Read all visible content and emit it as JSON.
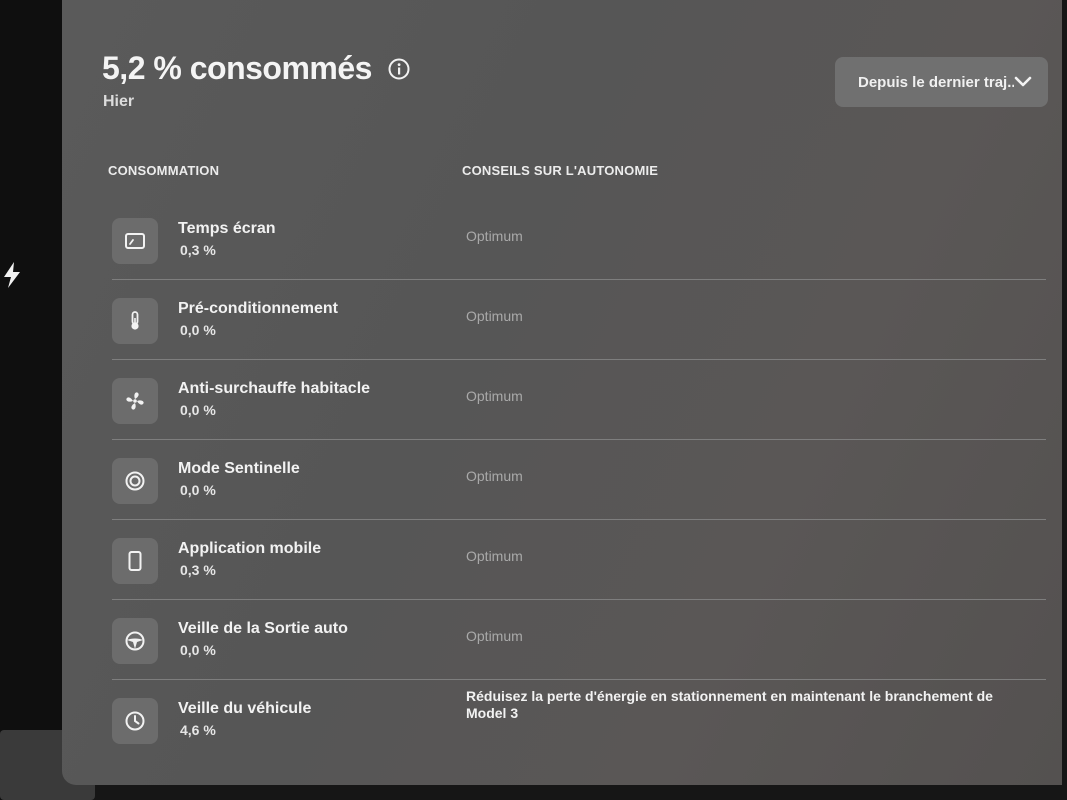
{
  "header": {
    "title": "5,2 % consommés",
    "subtitle": "Hier",
    "dropdown_label": "Depuis le dernier traj..."
  },
  "columns": {
    "consumption": "CONSOMMATION",
    "advice": "CONSEILS SUR L'AUTONOMIE"
  },
  "rows": [
    {
      "icon": "screen-icon",
      "name": "Temps écran",
      "value": "0,3 %",
      "advice": "Optimum"
    },
    {
      "icon": "thermometer-icon",
      "name": "Pré-conditionnement",
      "value": "0,0 %",
      "advice": "Optimum"
    },
    {
      "icon": "fan-icon",
      "name": "Anti-surchauffe habitacle",
      "value": "0,0 %",
      "advice": "Optimum"
    },
    {
      "icon": "sentry-icon",
      "name": "Mode Sentinelle",
      "value": "0,0 %",
      "advice": "Optimum"
    },
    {
      "icon": "phone-icon",
      "name": "Application mobile",
      "value": "0,3 %",
      "advice": "Optimum"
    },
    {
      "icon": "steering-wheel-icon",
      "name": "Veille de la Sortie auto",
      "value": "0,0 %",
      "advice": "Optimum"
    },
    {
      "icon": "clock-icon",
      "name": "Veille du véhicule",
      "value": "4,6 %",
      "advice": "Réduisez la perte d'énergie en stationnement en maintenant le branchement de Model 3"
    }
  ],
  "colors": {
    "panel": "#585858",
    "text": "#f2f2f2",
    "muted": "#a9a9a9",
    "icon_box": "#6c6c6c"
  }
}
